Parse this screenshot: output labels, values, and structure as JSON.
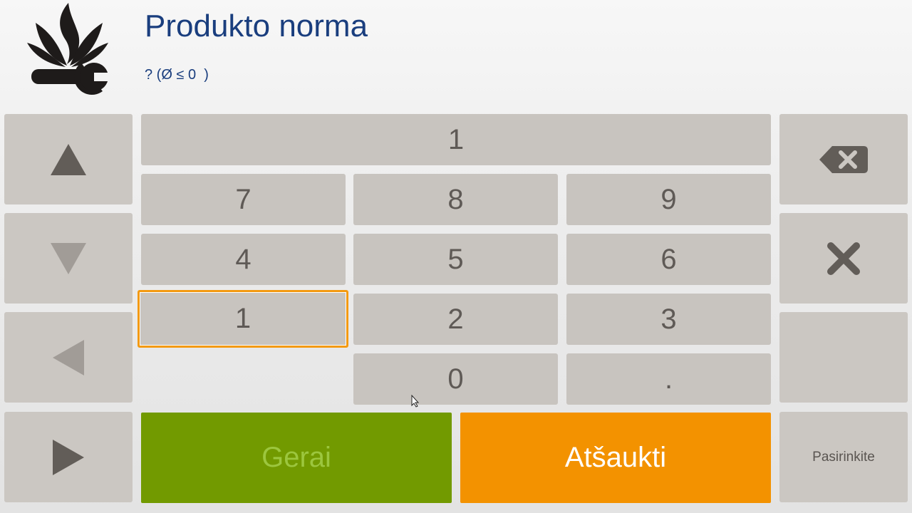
{
  "header": {
    "title": "Produkto norma",
    "subtitle": "? (Ø ≤ 0  )"
  },
  "display": {
    "value": "1"
  },
  "keypad": {
    "k7": "7",
    "k8": "8",
    "k9": "9",
    "k4": "4",
    "k5": "5",
    "k6": "6",
    "k1": "1",
    "k2": "2",
    "k3": "3",
    "k0": "0",
    "kdot": "."
  },
  "actions": {
    "ok_label": "Gerai",
    "cancel_label": "Atšaukti",
    "choose_label": "Pasirinkite"
  },
  "icons": {
    "logo": "plant-wrench-logo",
    "up": "triangle-up-icon",
    "down": "triangle-down-icon",
    "left": "triangle-left-icon",
    "right": "triangle-right-icon",
    "backspace": "backspace-icon",
    "clear": "close-icon"
  },
  "colors": {
    "title": "#1a3e7e",
    "key": "#c8c4bf",
    "focus": "#f39a12",
    "ok": "#729a00",
    "cancel": "#f39200"
  }
}
